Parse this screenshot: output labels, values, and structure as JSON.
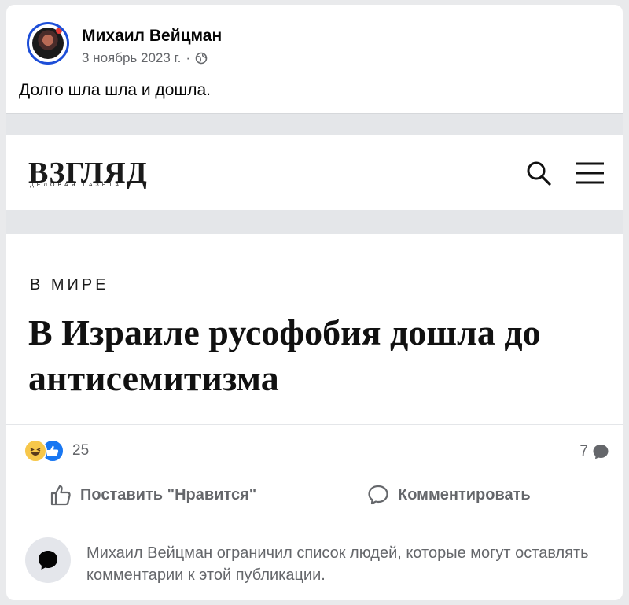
{
  "post": {
    "author": "Михаил Вейцман",
    "date": "3 ноябрь 2023 г.",
    "separator": "·",
    "text": "Долго шла шла и дошла."
  },
  "preview": {
    "logo": "ВЗГЛЯД",
    "logo_subtitle": "ДЕЛОВАЯ ГАЗЕТА",
    "category": "В МИРЕ",
    "headline": "В Израиле русофобия дошла до антисемитизма"
  },
  "stats": {
    "reactions_count": "25",
    "comments_count": "7"
  },
  "actions": {
    "like_label": "Поставить \"Нравится\"",
    "comment_label": "Комментировать"
  },
  "notice": {
    "text": "Михаил Вейцман ограничил список людей, которые могут оставлять комментарии к этой публикации."
  },
  "colors": {
    "like_blue": "#1877f2",
    "haha_yellow": "#f7c74a",
    "secondary_text": "#65676b"
  }
}
